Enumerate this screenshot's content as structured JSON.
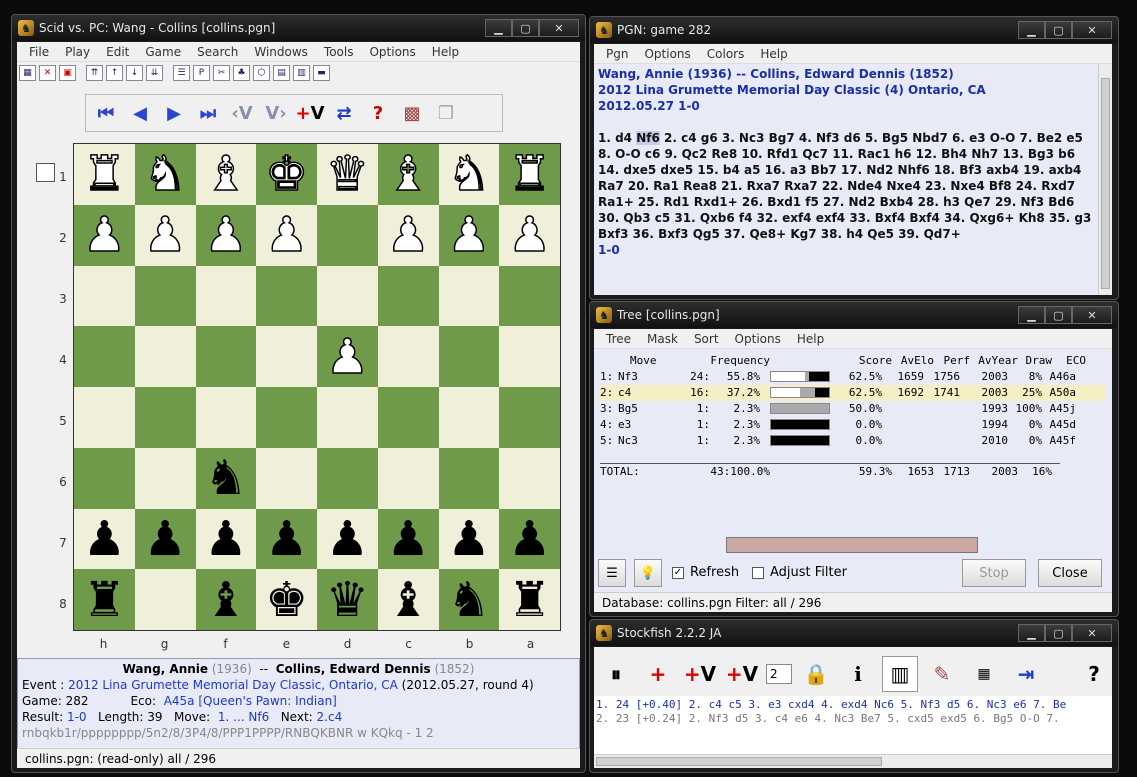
{
  "main_window": {
    "title": "Scid vs. PC: Wang - Collins [collins.pgn]",
    "menu": [
      "File",
      "Play",
      "Edit",
      "Game",
      "Search",
      "Windows",
      "Tools",
      "Options",
      "Help"
    ],
    "rank_labels": [
      "1",
      "2",
      "3",
      "4",
      "5",
      "6",
      "7",
      "8"
    ],
    "file_labels": [
      "h",
      "g",
      "f",
      "e",
      "d",
      "c",
      "b",
      "a"
    ],
    "board": [
      [
        "♜",
        "♞",
        "♝",
        "♚",
        "♛",
        "♝",
        "♞",
        "♜"
      ],
      [
        "♟",
        "♟",
        "♟",
        "♟",
        "",
        "♟",
        "♟",
        "♟"
      ],
      [
        "",
        "",
        "",
        "",
        "",
        "",
        "",
        ""
      ],
      [
        "",
        "",
        "",
        "",
        "♟",
        "",
        "",
        ""
      ],
      [
        "",
        "",
        "",
        "",
        "",
        "",
        "",
        ""
      ],
      [
        "",
        "",
        "♞",
        "",
        "",
        "",
        "",
        ""
      ],
      [
        "♟",
        "♟",
        "♟",
        "♟",
        "♟",
        "♟",
        "♟",
        "♟"
      ],
      [
        "♜",
        "",
        "♝",
        "♚",
        "♛",
        "♝",
        "♞",
        "♜"
      ]
    ],
    "board_colors": [
      [
        "w",
        "w",
        "w",
        "w",
        "w",
        "w",
        "w",
        "w"
      ],
      [
        "w",
        "w",
        "w",
        "w",
        "",
        "w",
        "w",
        "w"
      ],
      [
        "",
        "",
        "",
        "",
        "",
        "",
        "",
        ""
      ],
      [
        "",
        "",
        "",
        "",
        "w",
        "",
        "",
        ""
      ],
      [
        "",
        "",
        "",
        "",
        "",
        "",
        "",
        ""
      ],
      [
        "",
        "",
        "b",
        "",
        "",
        "",
        "",
        ""
      ],
      [
        "b",
        "b",
        "b",
        "b",
        "b",
        "b",
        "b",
        "b"
      ],
      [
        "b",
        "",
        "b",
        "b",
        "b",
        "b",
        "b",
        "b"
      ]
    ],
    "game_info": {
      "white": "Wang, Annie",
      "white_elo": "(1936)",
      "sep": "--",
      "black": "Collins, Edward Dennis",
      "black_elo": "(1852)",
      "event_label": "Event :",
      "event": "2012 Lina Grumette Memorial Day Classic, Ontario, CA",
      "event_date": "(2012.05.27, round 4)",
      "game_label": "Game: 282",
      "eco_label": "Eco:",
      "eco": "A45a [Queen's Pawn: Indian]",
      "result_label": "Result:",
      "result": "1-0",
      "length_label": "Length: 39",
      "move_label": "Move:",
      "move": "1. ... Nf6",
      "next_label": "Next:",
      "next": "2.c4",
      "fen": "rnbqkb1r/pppppppp/5n2/8/3P4/8/PPP1PPPP/RNBQKBNR w KQkq - 1 2"
    },
    "status": "collins.pgn:  (read-only)   all / 296"
  },
  "pgn_window": {
    "title": "PGN: game 282",
    "menu": [
      "Pgn",
      "Options",
      "Colors",
      "Help"
    ],
    "header_line1": "Wang, Annie  (1936)   --   Collins, Edward Dennis  (1852)",
    "header_line2": "2012 Lina Grumette Memorial Day Classic (4)  Ontario, CA",
    "header_line3": "2012.05.27  1-0",
    "moves_before": "1. d4 ",
    "current_move": "Nf6",
    "moves_after": " 2. c4 g6 3. Nc3 Bg7 4. Nf3 d6 5. Bg5 Nbd7 6. e3 O-O 7. Be2 e5 8. O-O c6 9. Qc2 Re8 10. Rfd1 Qc7 11. Rac1 h6 12. Bh4 Nh7 13. Bg3 b6 14. dxe5 dxe5 15. b4 a5 16. a3 Bb7 17. Nd2 Nhf6 18. Bf3 axb4 19. axb4 Ra7 20. Ra1 Rea8 21. Rxa7 Rxa7 22. Nde4 Nxe4 23. Nxe4 Bf8 24. Rxd7 Ra1+ 25. Rd1 Rxd1+ 26. Bxd1 f5 27. Nd2 Bxb4 28. h3 Qe7 29. Nf3 Bd6 30. Qb3 c5 31. Qxb6 f4 32. exf4 exf4 33. Bxf4 Bxf4 34. Qxg6+ Kh8 35. g3 Bxf3 36. Bxf3 Qg5 37. Qe8+ Kg7 38. h4 Qe5 39. Qd7+",
    "result": "1-0"
  },
  "tree_window": {
    "title": "Tree [collins.pgn]",
    "menu": [
      "Tree",
      "Mask",
      "Sort",
      "Options",
      "Help"
    ],
    "headers": {
      "move": "Move",
      "frequency": "Frequency",
      "score": "Score",
      "avelo": "AvElo",
      "perf": "Perf",
      "avyear": "AvYear",
      "draw": "Draw",
      "eco": "ECO"
    },
    "rows": [
      {
        "idx": "1:",
        "move": "Nf3",
        "count": "24:",
        "pct": "55.8%",
        "score": "62.5%",
        "avelo": "1659",
        "perf": "1756",
        "avyear": "2003",
        "draw": "8%",
        "eco": "A46a",
        "win": 0.58,
        "draw_frac": 0.08
      },
      {
        "idx": "2:",
        "move": "c4",
        "count": "16:",
        "pct": "37.2%",
        "score": "62.5%",
        "avelo": "1692",
        "perf": "1741",
        "avyear": "2003",
        "draw": "25%",
        "eco": "A50a",
        "win": 0.5,
        "draw_frac": 0.25
      },
      {
        "idx": "3:",
        "move": "Bg5",
        "count": "1:",
        "pct": "2.3%",
        "score": "50.0%",
        "avelo": "",
        "perf": "",
        "avyear": "1993",
        "draw": "100%",
        "eco": "A45j",
        "win": 0.0,
        "draw_frac": 1.0
      },
      {
        "idx": "4:",
        "move": "e3",
        "count": "1:",
        "pct": "2.3%",
        "score": "0.0%",
        "avelo": "",
        "perf": "",
        "avyear": "1994",
        "draw": "0%",
        "eco": "A45d",
        "win": 0.0,
        "draw_frac": 0.0
      },
      {
        "idx": "5:",
        "move": "Nc3",
        "count": "1:",
        "pct": "2.3%",
        "score": "0.0%",
        "avelo": "",
        "perf": "",
        "avyear": "2010",
        "draw": "0%",
        "eco": "A45f",
        "win": 0.0,
        "draw_frac": 0.0
      }
    ],
    "total": {
      "label": "TOTAL:",
      "count": "43:100.0%",
      "score": "59.3%",
      "avelo": "1653",
      "perf": "1713",
      "avyear": "2003",
      "draw": "16%"
    },
    "refresh_label": "Refresh",
    "adjust_label": "Adjust Filter",
    "stop_label": "Stop",
    "close_label": "Close",
    "status": "Database: collins.pgn   Filter: all / 296"
  },
  "engine_window": {
    "title": "Stockfish 2.2.2 JA",
    "multipv": "2",
    "line1": "1. 24 [+0.40]  2. c4 c5 3. e3 cxd4 4. exd4 Nc6 5. Nf3 d5 6. Nc3 e6 7. Be",
    "line2": "2. 23 [+0.24]  2. Nf3 d5 3. c4 e6 4. Nc3 Be7 5. cxd5 exd5 6. Bg5 O-O 7."
  }
}
